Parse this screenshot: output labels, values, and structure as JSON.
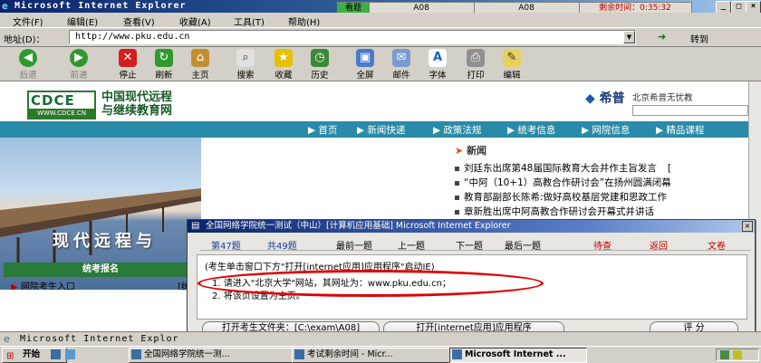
{
  "window": {
    "title": "Microsoft Internet Explorer",
    "btn_min": "_",
    "btn_max": "□",
    "btn_close": "×"
  },
  "exam_status": {
    "label": "看题",
    "code1": "A08",
    "code2": "A08",
    "remaining": "剩余时间：0:35:32"
  },
  "menu": [
    "文件(F)",
    "编辑(E)",
    "查看(V)",
    "收藏(A)",
    "工具(T)",
    "帮助(H)"
  ],
  "address": {
    "label": "地址(D)：",
    "url": "http://www.pku.edu.cn",
    "go": "转到"
  },
  "toolbar": [
    {
      "label": "后退",
      "icon": "back-arrow-icon"
    },
    {
      "label": "前进",
      "icon": "forward-arrow-icon"
    },
    {
      "label": "停止",
      "icon": "stop-icon"
    },
    {
      "label": "刷新",
      "icon": "refresh-icon"
    },
    {
      "label": "主页",
      "icon": "home-icon"
    },
    {
      "label": "搜索",
      "icon": "search-icon"
    },
    {
      "label": "收藏",
      "icon": "favorites-star-icon"
    },
    {
      "label": "历史",
      "icon": "history-icon"
    },
    {
      "label": "全屏",
      "icon": "fullscreen-icon"
    },
    {
      "label": "邮件",
      "icon": "mail-icon"
    },
    {
      "label": "字体",
      "icon": "font-icon"
    },
    {
      "label": "打印",
      "icon": "print-icon"
    },
    {
      "label": "编辑",
      "icon": "edit-icon"
    }
  ],
  "webpage": {
    "logo_text": "CDCE",
    "logo_url": "WWW.CDCE.CN",
    "site_name_1": "中国现代远程",
    "site_name_2": "与继续教育网",
    "partner": "希普",
    "partner_full": "北京希普无忧教",
    "nav": [
      "首页",
      "新闻快递",
      "政策法规",
      "统考信息",
      "网院信息",
      "精品课程"
    ],
    "banner_text": "现代远程与",
    "news_title": "新闻",
    "news": [
      "刘廷东出席第48届国际教育大会并作主旨发言",
      "“中阿（10+1）高教合作研讨会”在扬州圆满闭幕",
      "教育部副部长陈希:做好高校基层党建和思政工作",
      "章新胜出席中阿高教合作研讨会开幕式并讲话"
    ],
    "news_tag": "[",
    "sidebar_heading": "统考报名",
    "sidebar_link": "网院考生入口",
    "sidebar_link_2": "[统"
  },
  "dialog": {
    "title": "全国网络学院统一测试（中山）[计算机应用基础]  Microsoft Internet Explorer",
    "current": "第47题",
    "total": "共49题",
    "nav": [
      "最前一题",
      "上一题",
      "下一题",
      "最后一题"
    ],
    "actions": [
      "待查",
      "返回",
      "文卷"
    ],
    "instruction": "(考生单击窗口下方\"打开[internet应用]应用程序\"启动IE)",
    "step1": "1. 请进入\"北京大学\"网站，其网址为：www.pku.edu.cn；",
    "step2": "2. 将该页设置为主页。",
    "btn_folder": "打开考生文件夹：[C:\\exam\\A08]",
    "btn_app": "打开[internet应用]应用程序",
    "btn_grade": "评 分"
  },
  "statusbar": {
    "text": "Microsoft Internet Explor"
  },
  "taskbar": {
    "start": "开始",
    "tasks": [
      "全国网络学院统一测...",
      "考试剩余时间 - Micr...",
      "Microsoft Internet ..."
    ]
  }
}
